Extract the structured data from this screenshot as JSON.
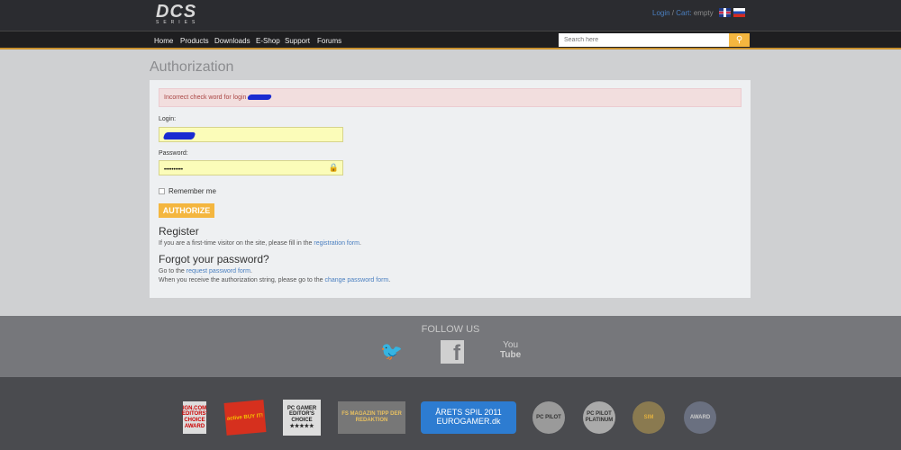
{
  "header": {
    "logo": "DCS",
    "logo_sub": "SERIES",
    "login": "Login",
    "cart_label": "Cart:",
    "cart_value": "empty"
  },
  "nav": {
    "items": [
      "Home",
      "Products",
      "Downloads",
      "E-Shop",
      "Support",
      "Forums"
    ],
    "search_placeholder": "Search here"
  },
  "page": {
    "title": "Authorization"
  },
  "form": {
    "error": "Incorrect check word for login",
    "login_label": "Login:",
    "password_label": "Password:",
    "password_value": "••••••••••",
    "remember": "Remember me",
    "submit": "AUTHORIZE"
  },
  "register": {
    "heading": "Register",
    "text": "If you are a first-time visitor on the site, please fill in the",
    "link": "registration form",
    "end": "."
  },
  "forgot": {
    "heading": "Forgot your password?",
    "text1": "Go to the",
    "link1": "request password form",
    "end1": ".",
    "text2": "When you receive the authorization string, please go to the",
    "link2": "change password form",
    "end2": "."
  },
  "footer": {
    "follow": "FOLLOW US",
    "badges": [
      "IGN.COM EDITORS' CHOICE AWARD",
      "active BUY IT!",
      "PC GAMER EDITOR'S CHOICE ★★★★★",
      "FS MAGAZIN TIPP DER REDAKTION",
      "ÅRETS SPIL 2011 EUROGAMER.dk",
      "PC PILOT",
      "PC PILOT PLATINUM",
      "SIM",
      "AWARD"
    ]
  }
}
